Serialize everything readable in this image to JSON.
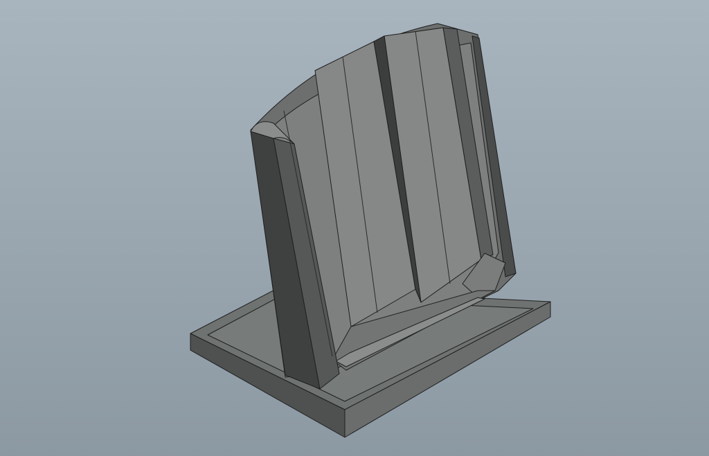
{
  "scene": {
    "model": "phone-stand",
    "colors": {
      "background_top": "#a8b4be",
      "background_bottom": "#8c99a3",
      "face_light": "#8a8d8c",
      "face_mid": "#6f7271",
      "face_dark": "#3f4140",
      "edge": "#1e1f1f"
    }
  }
}
